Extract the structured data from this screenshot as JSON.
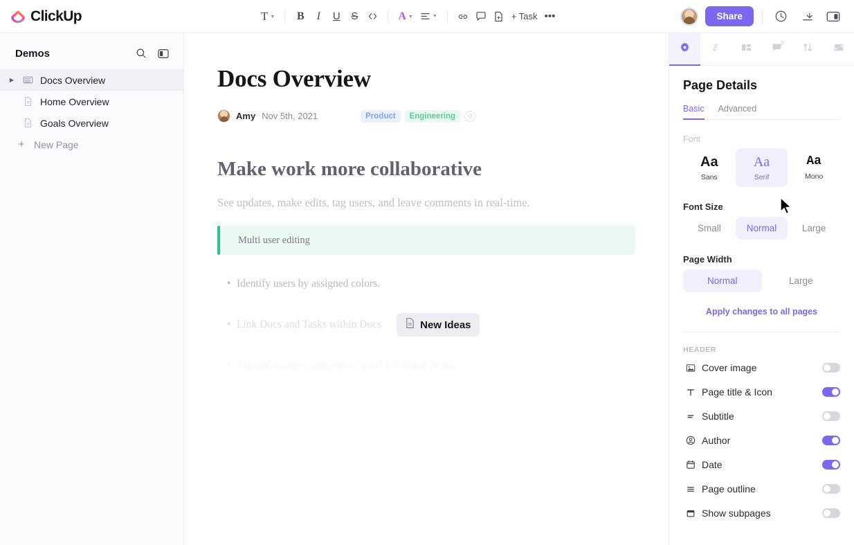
{
  "brand": {
    "name": "ClickUp",
    "logo_icon": "clickup-logo-icon"
  },
  "toolbar": {
    "text_style": "T",
    "bold": "B",
    "italic": "I",
    "underline": "U",
    "strikethrough": "S",
    "code": "<>",
    "text_color": "A",
    "align": "align-icon",
    "link": "link-icon",
    "comment": "comment-icon",
    "page": "page-icon",
    "task": "+ Task",
    "more": "•••"
  },
  "header_right": {
    "avatar": "user-avatar",
    "share_label": "Share",
    "history_icon": "clock-icon",
    "download_icon": "arrow-down-line-icon",
    "panel_icon": "panel-toggle-icon",
    "accent_color": "#7b68ee"
  },
  "sidebar": {
    "title": "Demos",
    "search_icon": "search-icon",
    "collapse_icon": "collapse-panel-icon",
    "items": [
      {
        "label": "Docs Overview",
        "icon": "book-icon",
        "active": true,
        "expandable": true
      },
      {
        "label": "Home Overview",
        "icon": "page-icon",
        "active": false,
        "expandable": false
      },
      {
        "label": "Goals Overview",
        "icon": "page-icon",
        "active": false,
        "expandable": false
      }
    ],
    "new_page_label": "New Page"
  },
  "document": {
    "title": "Docs Overview",
    "author": "Amy",
    "date": "Nov 5th, 2021",
    "tags": [
      {
        "label": "Product",
        "color": "#7ba6e8",
        "bg": "#eaf1fc"
      },
      {
        "label": "Engineering",
        "color": "#5ecb96",
        "bg": "#e9f8f1"
      }
    ],
    "heading": "Make work more collaborative",
    "paragraph": "See updates, make edits, tag users, and leave comments in real-time.",
    "callout": {
      "text": "Multi user editing",
      "accent": "#2ec58c",
      "bg": "#ecf8f2"
    },
    "bullets": [
      "Identify users by assigned colors.",
      "Link Docs and Tasks within Docs",
      "Tag and assign comments to users for action items."
    ],
    "chip": {
      "label": "New Ideas",
      "icon": "page-icon"
    }
  },
  "panel": {
    "tabs": [
      {
        "name": "settings-tab",
        "icon": "gear-icon",
        "active": true,
        "badge": ""
      },
      {
        "name": "relationships-tab",
        "icon": "link-icon",
        "active": false,
        "badge": ""
      },
      {
        "name": "layout-tab",
        "icon": "layout-icon",
        "active": false,
        "badge": ""
      },
      {
        "name": "comments-tab",
        "icon": "comment-icon",
        "active": false,
        "badge": "3"
      },
      {
        "name": "sort-tab",
        "icon": "sort-arrows-icon",
        "active": false,
        "badge": ""
      },
      {
        "name": "cover-tab",
        "icon": "image-icon",
        "active": false,
        "badge": ""
      }
    ],
    "title": "Page Details",
    "subtabs": [
      {
        "label": "Basic",
        "active": true
      },
      {
        "label": "Advanced",
        "active": false
      }
    ],
    "font_label": "Font",
    "font_options": [
      {
        "sample": "Aa",
        "label": "Sans",
        "selected": false
      },
      {
        "sample": "Aa",
        "label": "Serif",
        "selected": true
      },
      {
        "sample": "Aa",
        "label": "Mono",
        "selected": false
      }
    ],
    "font_size_label": "Font Size",
    "font_sizes": [
      {
        "label": "Small",
        "selected": false
      },
      {
        "label": "Normal",
        "selected": true
      },
      {
        "label": "Large",
        "selected": false
      }
    ],
    "page_width_label": "Page Width",
    "page_widths": [
      {
        "label": "Normal",
        "selected": true
      },
      {
        "label": "Large",
        "selected": false
      }
    ],
    "apply_link": "Apply changes to all pages",
    "header_section_label": "HEADER",
    "toggles": [
      {
        "label": "Cover image",
        "icon": "image-icon",
        "on": false
      },
      {
        "label": "Page title & Icon",
        "icon": "text-t-icon",
        "on": true
      },
      {
        "label": "Subtitle",
        "icon": "subtitle-icon",
        "on": false
      },
      {
        "label": "Author",
        "icon": "user-circle-icon",
        "on": true
      },
      {
        "label": "Date",
        "icon": "calendar-icon",
        "on": true
      },
      {
        "label": "Page outline",
        "icon": "list-icon",
        "on": false
      },
      {
        "label": "Show subpages",
        "icon": "window-icon",
        "on": false
      }
    ]
  }
}
